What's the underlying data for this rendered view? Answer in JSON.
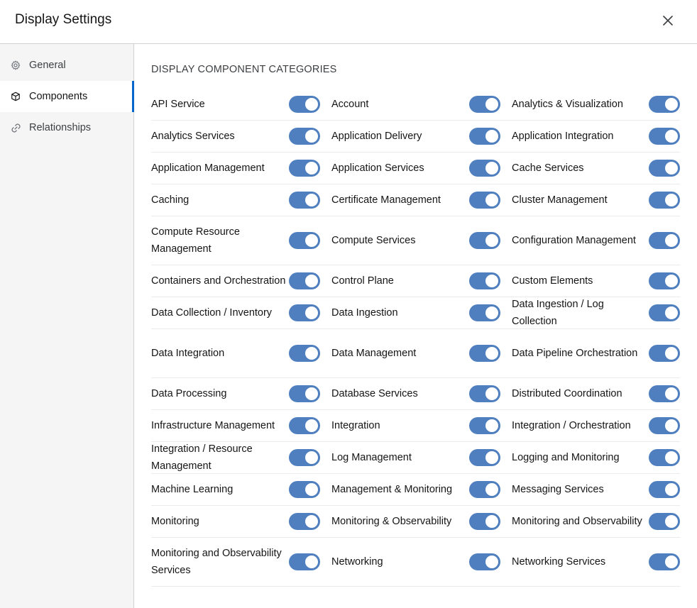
{
  "header": {
    "title": "Display Settings"
  },
  "sidebar": {
    "items": [
      {
        "label": "General",
        "icon": "gear-icon",
        "active": false
      },
      {
        "label": "Components",
        "icon": "cube-icon",
        "active": true
      },
      {
        "label": "Relationships",
        "icon": "link-icon",
        "active": false
      }
    ]
  },
  "main": {
    "section_title": "DISPLAY COMPONENT CATEGORIES",
    "categories": [
      {
        "label": "API Service",
        "enabled": true
      },
      {
        "label": "Account",
        "enabled": true
      },
      {
        "label": "Analytics & Visualization",
        "enabled": true
      },
      {
        "label": "Analytics Services",
        "enabled": true
      },
      {
        "label": "Application Delivery",
        "enabled": true
      },
      {
        "label": "Application Integration",
        "enabled": true
      },
      {
        "label": "Application Management",
        "enabled": true
      },
      {
        "label": "Application Services",
        "enabled": true
      },
      {
        "label": "Cache Services",
        "enabled": true
      },
      {
        "label": "Caching",
        "enabled": true
      },
      {
        "label": "Certificate Management",
        "enabled": true
      },
      {
        "label": "Cluster Management",
        "enabled": true
      },
      {
        "label": "Compute Resource Management",
        "enabled": true
      },
      {
        "label": "Compute Services",
        "enabled": true
      },
      {
        "label": "Configuration Management",
        "enabled": true
      },
      {
        "label": "Containers and Orchestration",
        "enabled": true
      },
      {
        "label": "Control Plane",
        "enabled": true
      },
      {
        "label": "Custom Elements",
        "enabled": true
      },
      {
        "label": "Data Collection / Inventory",
        "enabled": true
      },
      {
        "label": "Data Ingestion",
        "enabled": true
      },
      {
        "label": "Data Ingestion / Log Collection",
        "enabled": true
      },
      {
        "label": "Data Integration",
        "enabled": true
      },
      {
        "label": "Data Management",
        "enabled": true
      },
      {
        "label": "Data Pipeline Orchestration",
        "enabled": true
      },
      {
        "label": "Data Processing",
        "enabled": true
      },
      {
        "label": "Database Services",
        "enabled": true
      },
      {
        "label": "Distributed Coordination",
        "enabled": true
      },
      {
        "label": "Infrastructure Management",
        "enabled": true
      },
      {
        "label": "Integration",
        "enabled": true
      },
      {
        "label": "Integration / Orchestration",
        "enabled": true
      },
      {
        "label": "Integration / Resource Management",
        "enabled": true
      },
      {
        "label": "Log Management",
        "enabled": true
      },
      {
        "label": "Logging and Monitoring",
        "enabled": true
      },
      {
        "label": "Machine Learning",
        "enabled": true
      },
      {
        "label": "Management & Monitoring",
        "enabled": true
      },
      {
        "label": "Messaging Services",
        "enabled": true
      },
      {
        "label": "Monitoring",
        "enabled": true
      },
      {
        "label": "Monitoring & Observability",
        "enabled": true
      },
      {
        "label": "Monitoring and Observability",
        "enabled": true
      },
      {
        "label": "Monitoring and Observability Services",
        "enabled": true
      },
      {
        "label": "Networking",
        "enabled": true
      },
      {
        "label": "Networking Services",
        "enabled": true
      }
    ]
  },
  "colors": {
    "accent": "#0066cc",
    "toggle_on": "#4f7fbf"
  }
}
